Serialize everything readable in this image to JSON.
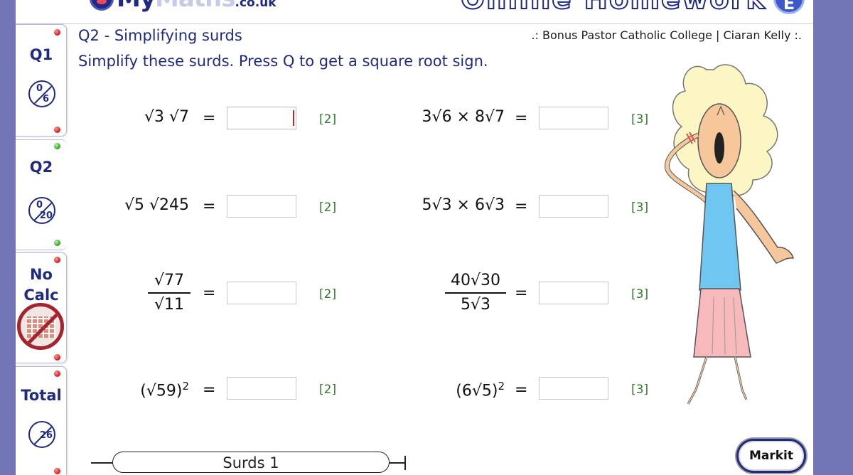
{
  "header": {
    "logo_my": "My",
    "logo_maths": "Maths",
    "logo_tld": ".co.uk",
    "banner": "Online Homework",
    "badge": "E"
  },
  "sidebar": {
    "sections": [
      {
        "label": "Q1",
        "score": "0",
        "total": "6"
      },
      {
        "label": "Q2",
        "score": "0",
        "total": "20"
      },
      {
        "label": "No Calc"
      },
      {
        "label": "Total",
        "score": "26"
      }
    ]
  },
  "question": {
    "title": "Q2 - Simplifying surds",
    "school": ".: Bonus Pastor Catholic College | Ciaran Kelly :.",
    "instructions": "Simplify these surds.  Press Q to get a square root sign."
  },
  "problems": [
    {
      "expr": "√3 √7",
      "marks": "[2]"
    },
    {
      "expr": "3√6 × 8√7",
      "marks": "[3]"
    },
    {
      "expr": "√5 √245",
      "marks": "[2]"
    },
    {
      "expr": "5√3 × 6√3",
      "marks": "[3]"
    },
    {
      "num": "√77",
      "den": "√11",
      "marks": "[2]"
    },
    {
      "num": "40√30",
      "den": "5√3",
      "marks": "[3]"
    },
    {
      "expr": "(√59)",
      "sup": "2",
      "marks": "[2]"
    },
    {
      "expr": "(6√5)",
      "sup": "2",
      "marks": "[3]"
    }
  ],
  "eq_sign": "=",
  "footer": {
    "exercise": "Surds 1",
    "markit": "Markit"
  }
}
